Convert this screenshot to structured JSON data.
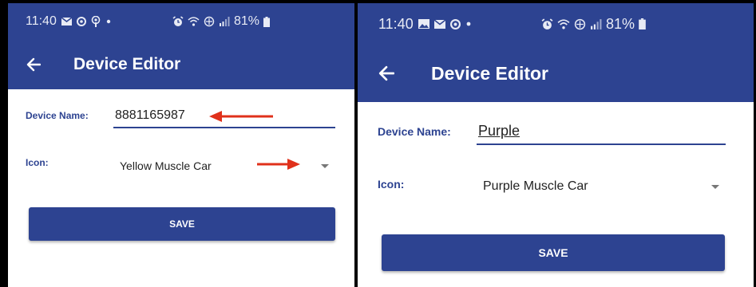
{
  "screens": [
    {
      "status": {
        "time": "11:40",
        "battery": "81%",
        "left_icons": [
          "mail-icon",
          "data-saver-icon",
          "podcast-icon",
          "dot-icon"
        ],
        "right_icons": [
          "alarm-icon",
          "wifi-icon",
          "hotspot-icon",
          "signal-icon",
          "battery-icon"
        ]
      },
      "appbar": {
        "title": "Device Editor",
        "back_icon": "back-arrow-icon"
      },
      "form": {
        "name_label": "Device Name:",
        "name_value": "8881165987",
        "icon_label": "Icon:",
        "icon_value": "Yellow Muscle Car",
        "save_label": "SAVE"
      },
      "annotations": {
        "arrow_color": "#e0311b"
      }
    },
    {
      "status": {
        "time": "11:40",
        "battery": "81%",
        "left_icons": [
          "gallery-icon",
          "mail-icon",
          "data-saver-icon",
          "dot-icon"
        ],
        "right_icons": [
          "alarm-icon",
          "wifi-icon",
          "hotspot-icon",
          "signal-icon",
          "battery-icon"
        ]
      },
      "appbar": {
        "title": "Device Editor",
        "back_icon": "back-arrow-icon"
      },
      "form": {
        "name_label": "Device Name:",
        "name_value": "Purple",
        "icon_label": "Icon:",
        "icon_value": "Purple Muscle Car",
        "save_label": "SAVE"
      }
    }
  ],
  "colors": {
    "primary": "#2d4391",
    "background": "#ffffff",
    "divider": "#000000"
  }
}
